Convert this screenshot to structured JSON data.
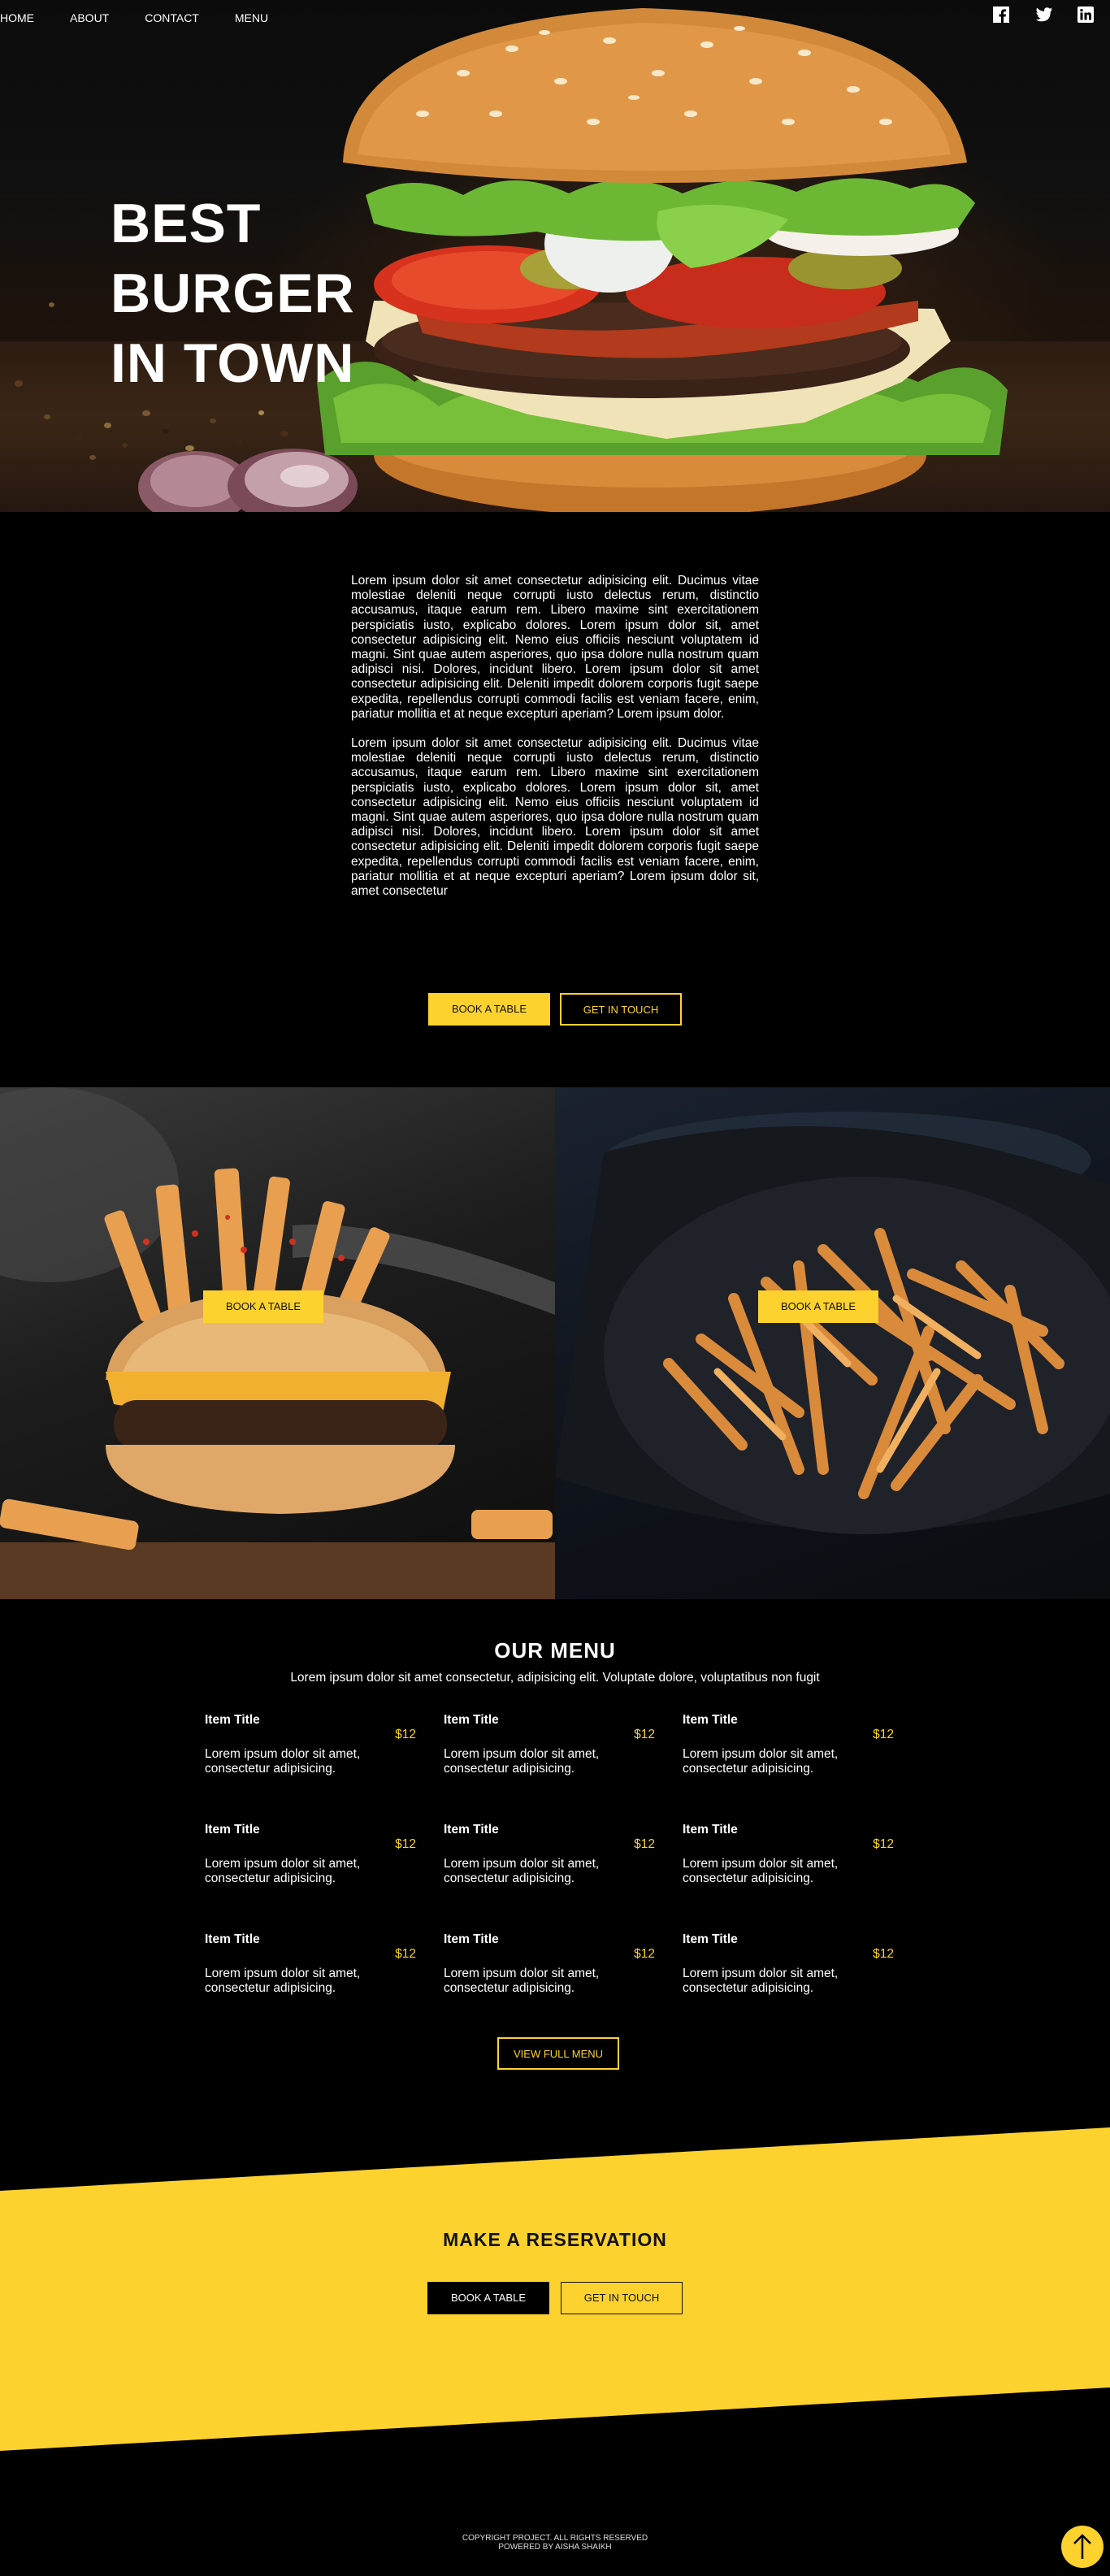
{
  "nav": {
    "items": [
      "HOME",
      "ABOUT",
      "CONTACT",
      "MENU"
    ]
  },
  "social": {
    "icons": [
      "facebook-icon",
      "twitter-icon",
      "linkedin-icon"
    ]
  },
  "hero": {
    "title_lines": [
      "BEST",
      "BURGER",
      "IN TOWN"
    ]
  },
  "intro": {
    "paragraphs": [
      "Lorem ipsum dolor sit amet consectetur adipisicing elit. Ducimus vitae molestiae deleniti neque corrupti iusto delectus rerum, distinctio accusamus, itaque earum rem. Libero maxime sint exercitationem perspiciatis iusto, explicabo dolores. Lorem ipsum dolor sit, amet consectetur adipisicing elit. Nemo eius officiis nesciunt voluptatem id magni. Sint quae autem asperiores, quo ipsa dolore nulla nostrum quam adipisci nisi. Dolores, incidunt libero. Lorem ipsum dolor sit amet consectetur adipisicing elit. Deleniti impedit dolorem corporis fugit saepe expedita, repellendus corrupti commodi facilis est veniam facere, enim, pariatur mollitia et at neque excepturi aperiam? Lorem ipsum dolor.",
      "Lorem ipsum dolor sit amet consectetur adipisicing elit. Ducimus vitae molestiae deleniti neque corrupti iusto delectus rerum, distinctio accusamus, itaque earum rem. Libero maxime sint exercitationem perspiciatis iusto, explicabo dolores. Lorem ipsum dolor sit, amet consectetur adipisicing elit. Nemo eius officiis nesciunt voluptatem id magni. Sint quae autem asperiores, quo ipsa dolore nulla nostrum quam adipisci nisi. Dolores, incidunt libero. Lorem ipsum dolor sit amet consectetur adipisicing elit. Deleniti impedit dolorem corporis fugit saepe expedita, repellendus corrupti commodi facilis est veniam facere, enim, pariatur mollitia et at neque excepturi aperiam? Lorem ipsum dolor sit, amet consectetur"
    ],
    "book_label": "BOOK A TABLE",
    "touch_label": "GET IN TOUCH"
  },
  "photos": {
    "left_button": "BOOK A TABLE",
    "right_button": "BOOK A TABLE"
  },
  "menu": {
    "title": "OUR MENU",
    "subtitle": "Lorem ipsum dolor sit amet consectetur, adipisicing elit. Voluptate dolore, voluptatibus non fugit",
    "items": [
      {
        "title": "Item Title",
        "price": "$12",
        "desc": "Lorem ipsum dolor sit amet, consectetur adipisicing."
      },
      {
        "title": "Item Title",
        "price": "$12",
        "desc": "Lorem ipsum dolor sit amet, consectetur adipisicing."
      },
      {
        "title": "Item Title",
        "price": "$12",
        "desc": "Lorem ipsum dolor sit amet, consectetur adipisicing."
      },
      {
        "title": "Item Title",
        "price": "$12",
        "desc": "Lorem ipsum dolor sit amet, consectetur adipisicing."
      },
      {
        "title": "Item Title",
        "price": "$12",
        "desc": "Lorem ipsum dolor sit amet, consectetur adipisicing."
      },
      {
        "title": "Item Title",
        "price": "$12",
        "desc": "Lorem ipsum dolor sit amet, consectetur adipisicing."
      },
      {
        "title": "Item Title",
        "price": "$12",
        "desc": "Lorem ipsum dolor sit amet, consectetur adipisicing."
      },
      {
        "title": "Item Title",
        "price": "$12",
        "desc": "Lorem ipsum dolor sit amet, consectetur adipisicing."
      },
      {
        "title": "Item Title",
        "price": "$12",
        "desc": "Lorem ipsum dolor sit amet, consectetur adipisicing."
      }
    ],
    "view_full_label": "VIEW FULL MENU"
  },
  "reservation": {
    "title": "MAKE A RESERVATION",
    "book_label": "BOOK A TABLE",
    "touch_label": "GET IN TOUCH"
  },
  "footer": {
    "copyright": "COPYRIGHT PROJECT. ALL RIGHTS RESERVED",
    "powered": "POWERED BY AISHA SHAIKH"
  },
  "colors": {
    "accent": "#fdd22e",
    "background": "#000000",
    "text": "#ffffff"
  }
}
